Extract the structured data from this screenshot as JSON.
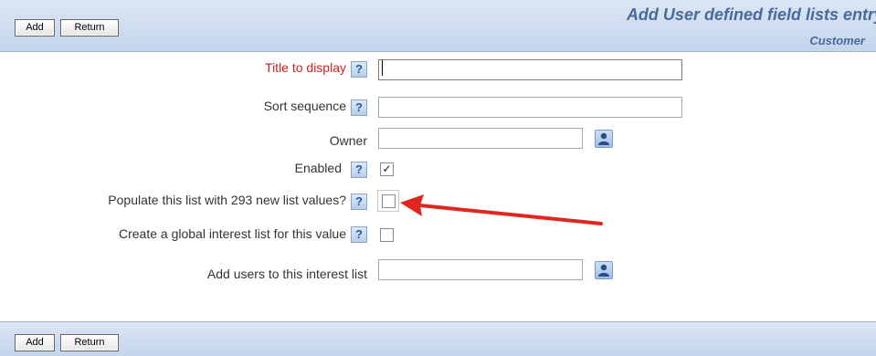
{
  "toolbar": {
    "add_label": "Add",
    "return_label": "Return"
  },
  "header": {
    "title": "Add User defined field lists entry",
    "subtitle": "Customer"
  },
  "form": {
    "title_label": "Title to display",
    "title_value": "",
    "sort_label": "Sort sequence",
    "sort_value": "",
    "owner_label": "Owner",
    "owner_value": "",
    "enabled_label": "Enabled",
    "enabled_checked": true,
    "populate_label": "Populate this list with 293 new list values?",
    "populate_checked": false,
    "global_label": "Create a global interest list for this value",
    "global_checked": false,
    "users_label": "Add users to this interest list",
    "users_value": "",
    "help_glyph": "?",
    "check_glyph": "✓"
  },
  "icons": {
    "help": "help-icon",
    "user_lookup": "user-icon",
    "annotation": "red-arrow-annotation"
  },
  "colors": {
    "required_label": "#cc2222",
    "header_text": "#4a6a9a",
    "annotation_arrow": "#e0261e"
  }
}
